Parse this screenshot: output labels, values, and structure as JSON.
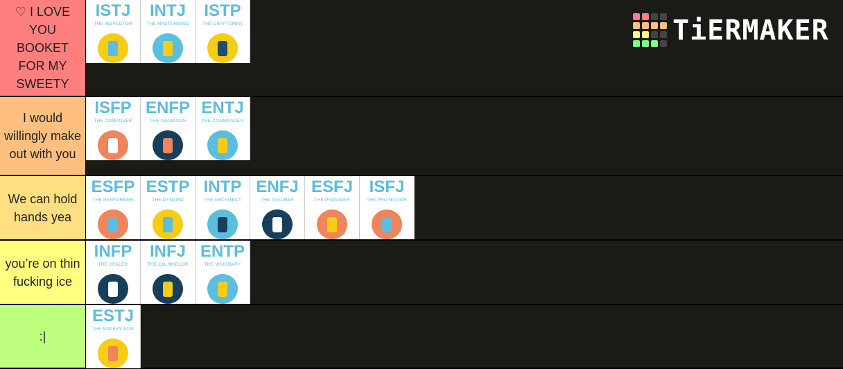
{
  "background": "#1a1a17",
  "tiers": [
    {
      "label": "♡ I LOVE YOU BOOKET FOR MY SWEETY",
      "color": "#ff7f7f",
      "height": 140,
      "items": [
        {
          "code": "ISTJ",
          "title": "THE INSPECTOR",
          "icon": "book-magnifier-icon",
          "bg": "#f7cc14",
          "fg": "#5bbde0"
        },
        {
          "code": "INTJ",
          "title": "THE MASTERMIND",
          "icon": "chess-king-icon",
          "bg": "#5bbde0",
          "fg": "#f7cc14"
        },
        {
          "code": "ISTP",
          "title": "THE CRAFTSMAN",
          "icon": "hammer-icon",
          "bg": "#f7cc14",
          "fg": "#1f4d6b"
        }
      ]
    },
    {
      "label": "I would willingly make out with you",
      "color": "#ffbf7f",
      "height": 114,
      "items": [
        {
          "code": "ISFP",
          "title": "THE COMPOSER",
          "icon": "palette-icon",
          "bg": "#f0845a",
          "fg": "#ffffff"
        },
        {
          "code": "ENFP",
          "title": "THE CHAMPION",
          "icon": "medal-icon",
          "bg": "#163f5c",
          "fg": "#f0845a"
        },
        {
          "code": "ENTJ",
          "title": "THE COMMANDER",
          "icon": "commander-icon",
          "bg": "#5bbde0",
          "fg": "#f7cc14"
        }
      ]
    },
    {
      "label": "We can hold hands yea",
      "color": "#ffdf7f",
      "height": 93,
      "items": [
        {
          "code": "ESFP",
          "title": "THE PERFORMER",
          "icon": "microphone-icon",
          "bg": "#f0845a",
          "fg": "#5bbde0"
        },
        {
          "code": "ESTP",
          "title": "THE DYNAMO",
          "icon": "lightning-icon",
          "bg": "#f7cc14",
          "fg": "#5bbde0"
        },
        {
          "code": "INTP",
          "title": "THE ARCHITECT",
          "icon": "globe-thinker-icon",
          "bg": "#5bbde0",
          "fg": "#163f5c"
        },
        {
          "code": "ENFJ",
          "title": "THE TEACHER",
          "icon": "chalkboard-icon",
          "bg": "#163f5c",
          "fg": "#ffffff"
        },
        {
          "code": "ESFJ",
          "title": "THE PROVIDER",
          "icon": "bread-icon",
          "bg": "#f0845a",
          "fg": "#f7cc14"
        },
        {
          "code": "ISFJ",
          "title": "THE PROTECTOR",
          "icon": "shield-heart-icon",
          "bg": "#f0845a",
          "fg": "#5bbde0"
        }
      ]
    },
    {
      "label": "you’re on thin fucking ice",
      "color": "#ffff7f",
      "height": 93,
      "items": [
        {
          "code": "INFP",
          "title": "THE HEALER",
          "icon": "hands-plant-icon",
          "bg": "#163f5c",
          "fg": "#ffffff"
        },
        {
          "code": "INFJ",
          "title": "THE COUNSELOR",
          "icon": "counselor-icon",
          "bg": "#163f5c",
          "fg": "#f7cc14"
        },
        {
          "code": "ENTP",
          "title": "THE VISIONARY",
          "icon": "lightbulb-icon",
          "bg": "#5bbde0",
          "fg": "#f7cc14"
        }
      ]
    },
    {
      "label": ":|",
      "color": "#bfff7f",
      "height": 92,
      "items": [
        {
          "code": "ESTJ",
          "title": "THE SUPERVISOR",
          "icon": "clipboard-icon",
          "bg": "#f7cc14",
          "fg": "#f0845a"
        }
      ]
    }
  ],
  "logo": {
    "text": "TiERMAKER",
    "grid": [
      "#ff7f7f",
      "#ff7f7f",
      "#444",
      "#444",
      "#ffbf7f",
      "#ffbf7f",
      "#ffbf7f",
      "#ffbf7f",
      "#ffff7f",
      "#ffff7f",
      "#444",
      "#444",
      "#7fff7f",
      "#7fff7f",
      "#7fff7f",
      "#444"
    ]
  }
}
